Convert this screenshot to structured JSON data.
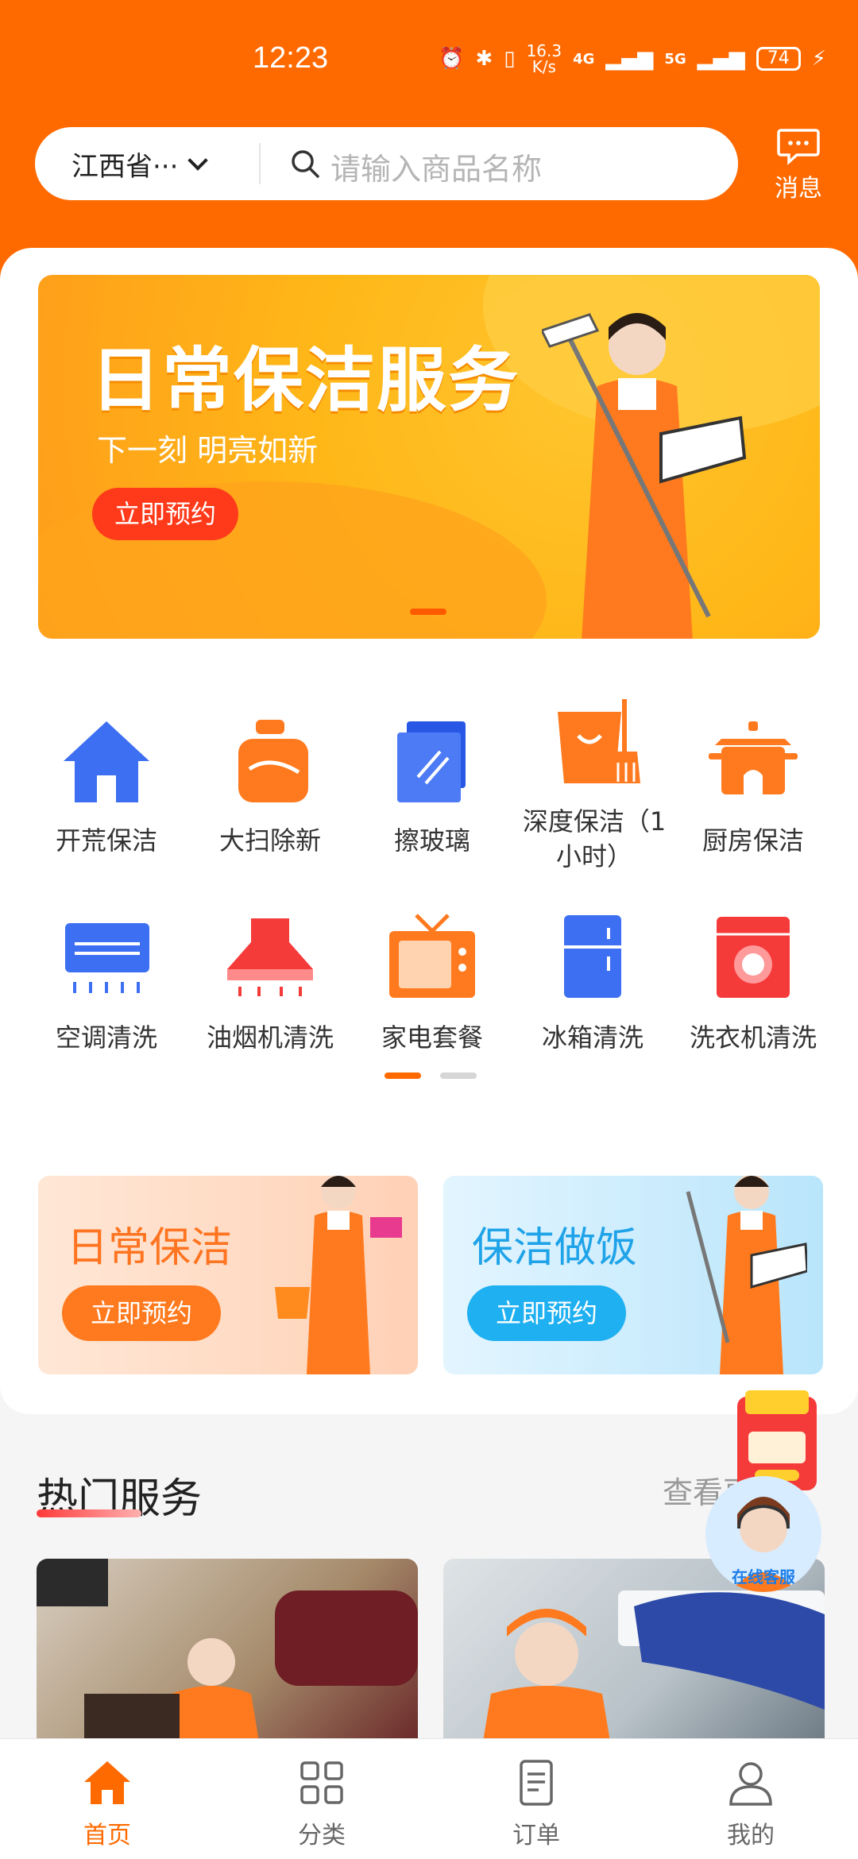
{
  "status_bar": {
    "time": "12:23",
    "net_speed_top": "16.3",
    "net_speed_bottom": "K/s",
    "sig1": "4G",
    "sig2": "5G",
    "battery": "74"
  },
  "header": {
    "region": "江西省···",
    "search_placeholder": "请输入商品名称",
    "message_label": "消息"
  },
  "banner": {
    "title": "日常保洁服务",
    "subtitle": "下一刻  明亮如新",
    "button": "立即预约"
  },
  "categories": [
    {
      "label": "开荒保洁",
      "icon": "house-icon"
    },
    {
      "label": "大扫除新",
      "icon": "spray-bottle-icon"
    },
    {
      "label": "擦玻璃",
      "icon": "glass-icon"
    },
    {
      "label": "深度保洁（1小时）",
      "icon": "bucket-broom-icon"
    },
    {
      "label": "厨房保洁",
      "icon": "pot-icon"
    },
    {
      "label": "空调清洗",
      "icon": "air-conditioner-icon"
    },
    {
      "label": "油烟机清洗",
      "icon": "range-hood-icon"
    },
    {
      "label": "家电套餐",
      "icon": "tv-icon"
    },
    {
      "label": "冰箱清洗",
      "icon": "fridge-icon"
    },
    {
      "label": "洗衣机清洗",
      "icon": "washing-machine-icon"
    }
  ],
  "promos": [
    {
      "title": "日常保洁",
      "button": "立即预约"
    },
    {
      "title": "保洁做饭",
      "button": "立即预约"
    }
  ],
  "hot": {
    "title": "热门服务",
    "more": "查看更多"
  },
  "floating": {
    "customer_service": "在线客服"
  },
  "nav": [
    {
      "label": "首页",
      "active": true
    },
    {
      "label": "分类",
      "active": false
    },
    {
      "label": "订单",
      "active": false
    },
    {
      "label": "我的",
      "active": false
    }
  ],
  "colors": {
    "brand": "#ff6a00",
    "blue": "#3d6ff2",
    "red": "#f53a3a"
  }
}
